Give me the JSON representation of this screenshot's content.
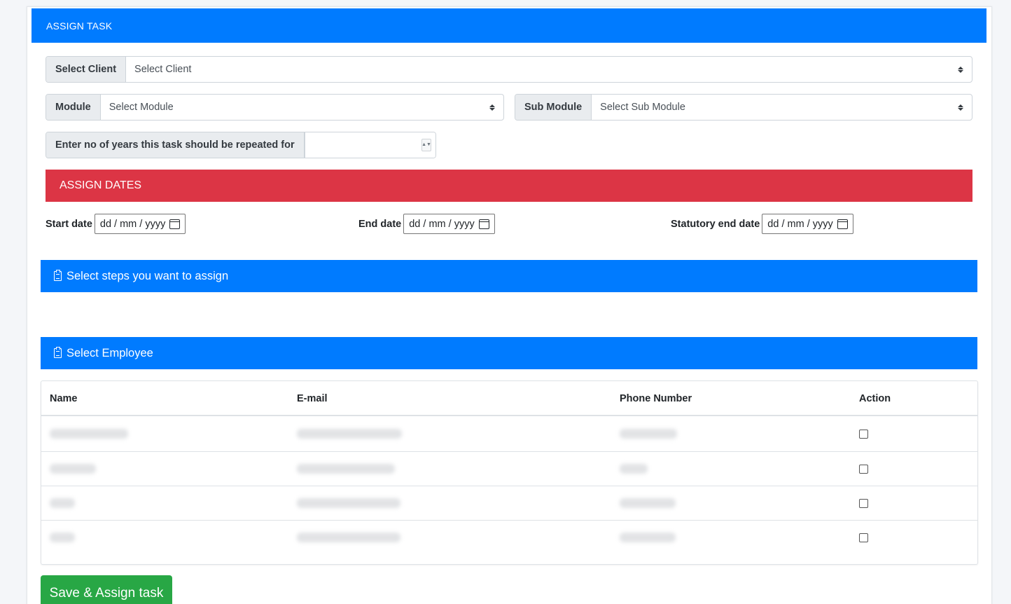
{
  "header": {
    "title": "ASSIGN TASK"
  },
  "client": {
    "label": "Select Client",
    "value": "Select Client"
  },
  "module": {
    "label": "Module",
    "value": "Select Module"
  },
  "submodule": {
    "label": "Sub Module",
    "value": "Select Sub Module"
  },
  "years": {
    "label": "Enter no of years this task should be repeated for",
    "value": ""
  },
  "dates": {
    "title": "ASSIGN DATES",
    "start_label": "Start date",
    "end_label": "End date",
    "statutory_label": "Statutory end date",
    "placeholder": "dd / mm / yyyy"
  },
  "steps": {
    "title": "Select steps you want to assign"
  },
  "employee": {
    "title": "Select Employee",
    "columns": [
      "Name",
      "E-mail",
      "Phone Number",
      "Action"
    ],
    "row_count": 4
  },
  "save_label": "Save & Assign task",
  "colors": {
    "primary": "#007bff",
    "danger": "#dc3545",
    "success": "#28a745"
  }
}
